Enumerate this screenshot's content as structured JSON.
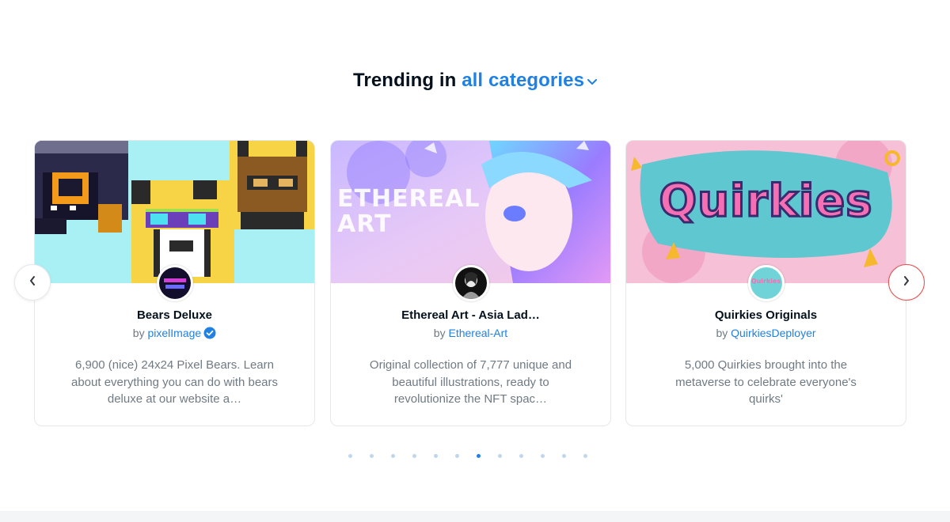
{
  "heading": {
    "prefix": "Trending in",
    "category": "all categories",
    "chevron_icon": "chevron-down-icon"
  },
  "colors": {
    "accent": "#2081e2",
    "text": "#04111d",
    "muted": "#707a83",
    "next_button_border": "#e05252"
  },
  "carousel": {
    "prev_icon": "chevron-left-icon",
    "next_icon": "chevron-right-icon",
    "dot_count": 12,
    "active_dot_index": 6
  },
  "cards": [
    {
      "title": "Bears Deluxe",
      "by_label": "by",
      "creator": "pixelImage",
      "verified": true,
      "description": "6,900 (nice) 24x24 Pixel Bears. Learn about everything you can do with bears deluxe at our website a…"
    },
    {
      "title": "Ethereal Art - Asia Lad…",
      "by_label": "by",
      "creator": "Ethereal-Art",
      "verified": false,
      "banner_text_line1": "ETHEREAL",
      "banner_text_line2": "ART",
      "description": "Original collection of 7,777 unique and beautiful illustrations, ready to revolutionize the NFT spac…"
    },
    {
      "title": "Quirkies Originals",
      "by_label": "by",
      "creator": "QuirkiesDeployer",
      "verified": false,
      "banner_text": "Quirkies",
      "avatar_text": "Quirkies",
      "description": "5,000 Quirkies brought into the metaverse to celebrate everyone's quirks'"
    }
  ]
}
